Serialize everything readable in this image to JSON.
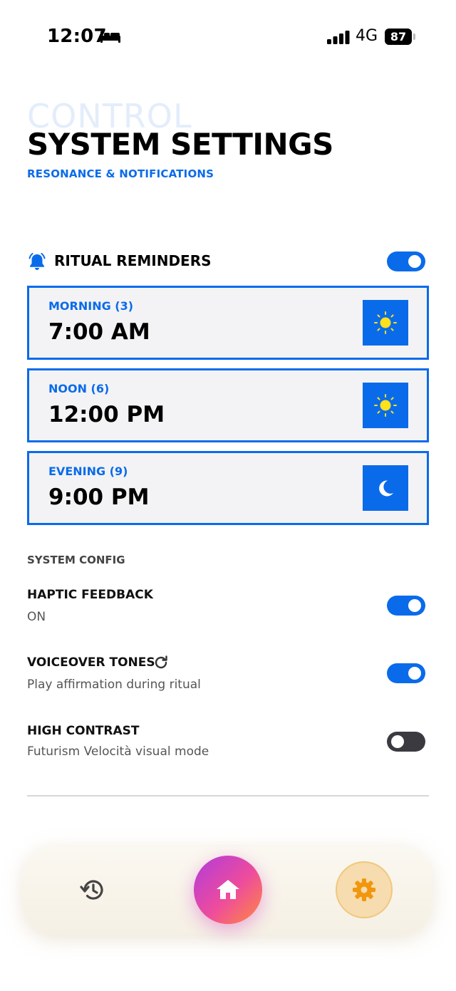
{
  "status_bar": {
    "time": "12:07",
    "network": "4G",
    "battery": "87",
    "icons": [
      "bed-icon",
      "signal-icon",
      "battery-icon"
    ]
  },
  "header": {
    "ghost_title": "CONTROL",
    "title": "SYSTEM SETTINGS",
    "subtitle": "RESONANCE & NOTIFICATIONS"
  },
  "reminders": {
    "label": "RITUAL REMINDERS",
    "icon": "bell-icon",
    "enabled": true,
    "items": [
      {
        "label": "MORNING (3)",
        "time": "7:00 AM",
        "icon": "sun-icon"
      },
      {
        "label": "NOON (6)",
        "time": "12:00 PM",
        "icon": "sun-icon"
      },
      {
        "label": "EVENING (9)",
        "time": "9:00 PM",
        "icon": "moon-icon"
      }
    ]
  },
  "system_config": {
    "heading": "SYSTEM CONFIG",
    "settings": [
      {
        "title": "HAPTIC FEEDBACK",
        "description": "ON",
        "enabled": true
      },
      {
        "title": "VOICEOVER TONES",
        "description": "Play affirmation during ritual",
        "enabled": true,
        "icon": "refresh-icon"
      },
      {
        "title": "HIGH CONTRAST",
        "description": "Futurism Velocità visual mode",
        "enabled": false
      }
    ]
  },
  "nav": {
    "items": [
      "history-icon",
      "home-icon",
      "gear-icon"
    ],
    "active": "home"
  },
  "colors": {
    "accent": "#0a6bea",
    "sun": "#ffe11a",
    "toggle_off": "#3a3a40",
    "settings_icon": "#f2960d"
  }
}
